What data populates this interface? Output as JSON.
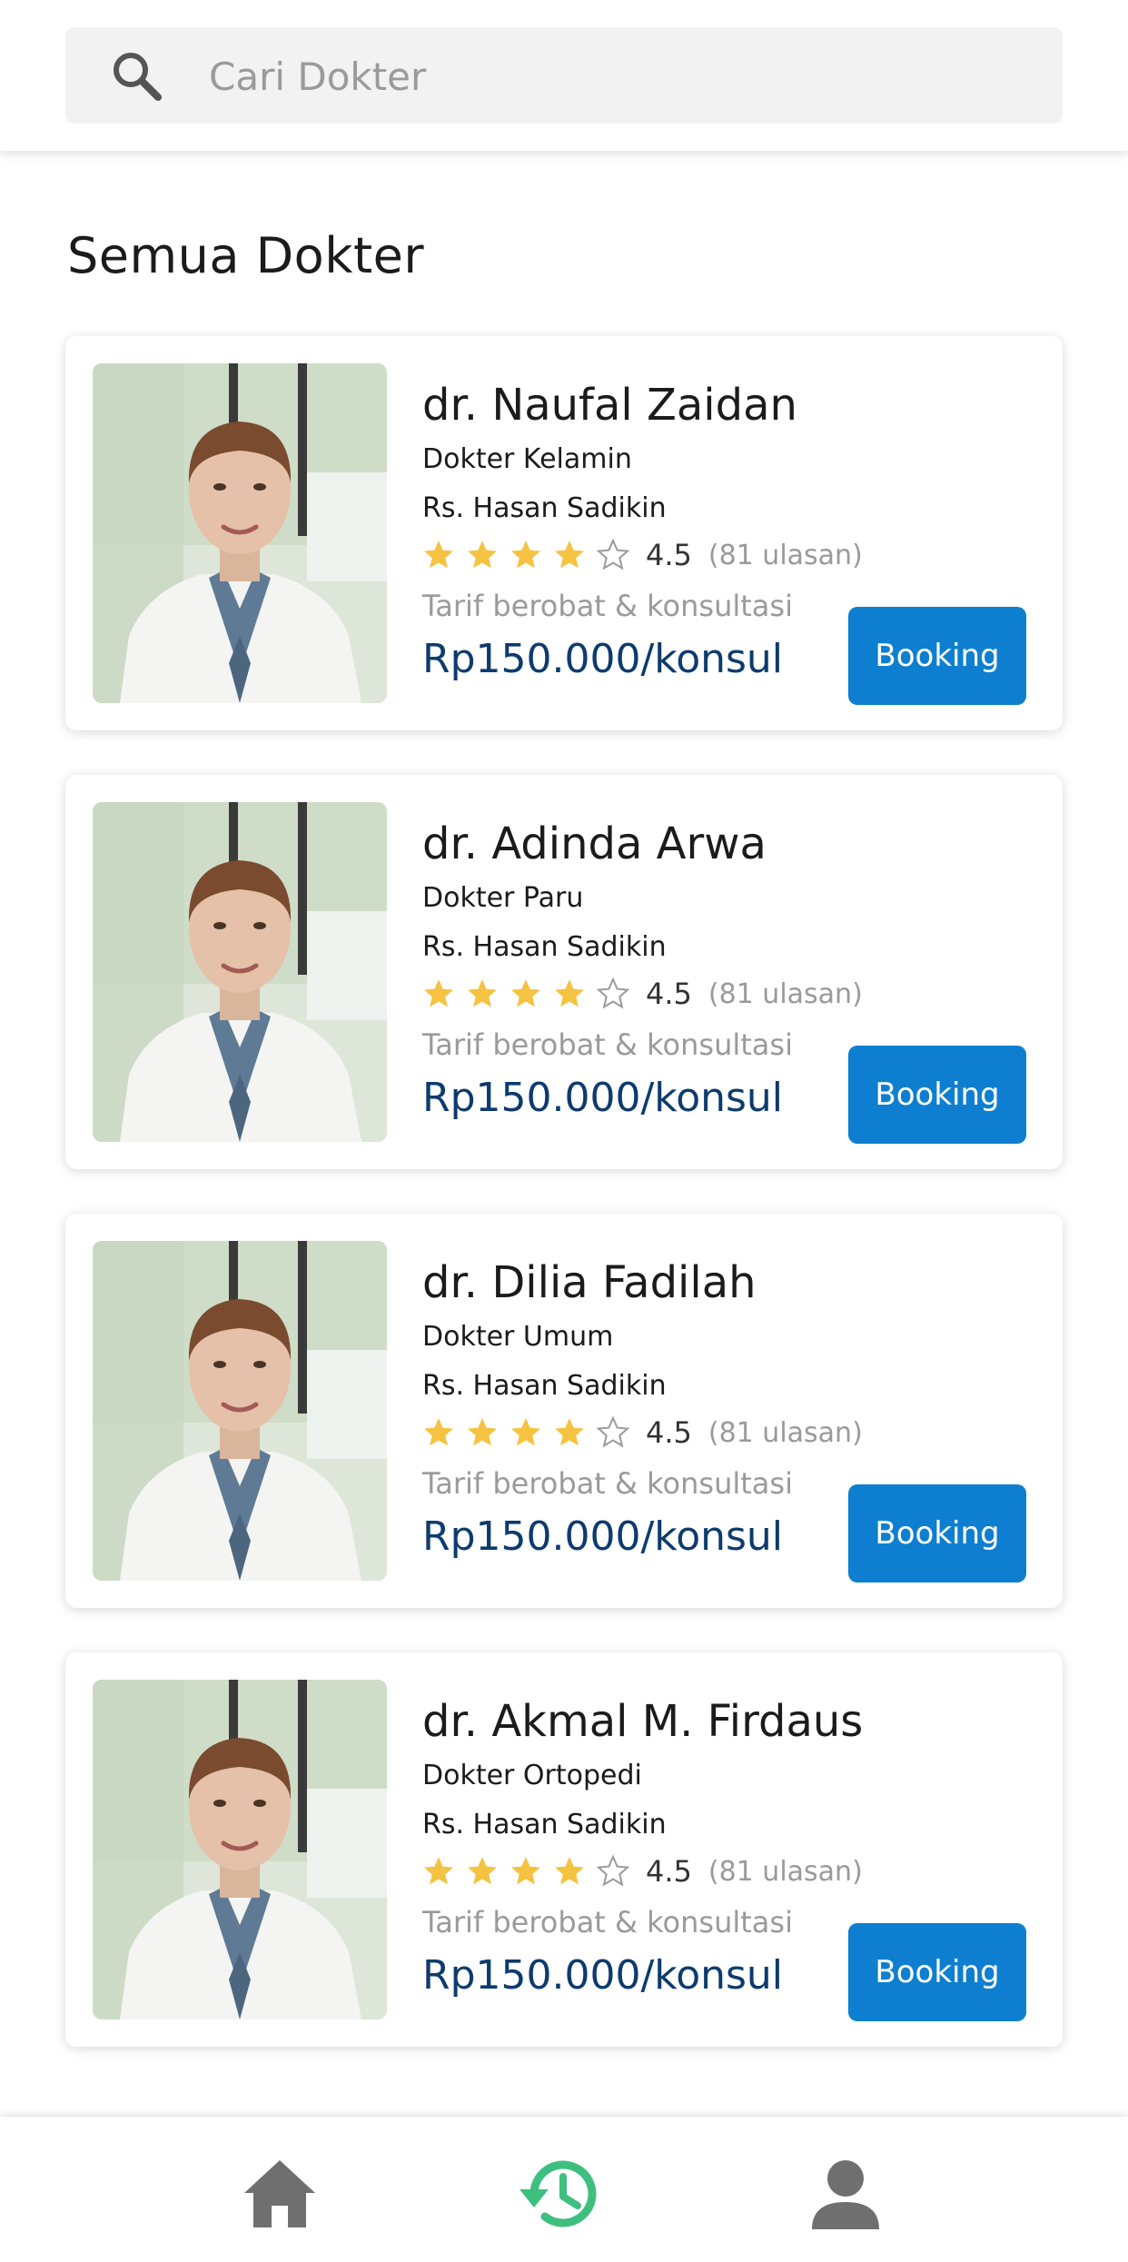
{
  "search": {
    "placeholder": "Cari Dokter",
    "value": ""
  },
  "section_title": "Semua Dokter",
  "doctors": [
    {
      "name": "dr. Naufal Zaidan",
      "specialty": "Dokter Kelamin",
      "hospital": "Rs. Hasan Sadikin",
      "rating": "4.5",
      "stars": 4,
      "reviews": "(81 ulasan)",
      "tariff_label": "Tarif berobat & konsultasi",
      "price": "Rp150.000/konsul",
      "button": "Booking"
    },
    {
      "name": "dr. Adinda Arwa",
      "specialty": "Dokter Paru",
      "hospital": "Rs. Hasan Sadikin",
      "rating": "4.5",
      "stars": 4,
      "reviews": "(81 ulasan)",
      "tariff_label": "Tarif berobat & konsultasi",
      "price": "Rp150.000/konsul",
      "button": "Booking"
    },
    {
      "name": "dr. Dilia Fadilah",
      "specialty": "Dokter Umum",
      "hospital": "Rs. Hasan Sadikin",
      "rating": "4.5",
      "stars": 4,
      "reviews": "(81 ulasan)",
      "tariff_label": "Tarif berobat & konsultasi",
      "price": "Rp150.000/konsul",
      "button": "Booking"
    },
    {
      "name": "dr. Akmal M. Firdaus",
      "specialty": "Dokter Ortopedi",
      "hospital": "Rs. Hasan Sadikin",
      "rating": "4.5",
      "stars": 4,
      "reviews": "(81 ulasan)",
      "tariff_label": "Tarif berobat & konsultasi",
      "price": "Rp150.000/konsul",
      "button": "Booking"
    }
  ],
  "bottom_nav": [
    {
      "icon": "home-icon",
      "active": false
    },
    {
      "icon": "history-icon",
      "active": true
    },
    {
      "icon": "profile-icon",
      "active": false
    }
  ],
  "colors": {
    "accent": "#0e7fd0",
    "price": "#0d3b6e",
    "star": "#f5c242",
    "nav_active": "#3fbf7f",
    "nav_inactive": "#6f6f6f"
  }
}
